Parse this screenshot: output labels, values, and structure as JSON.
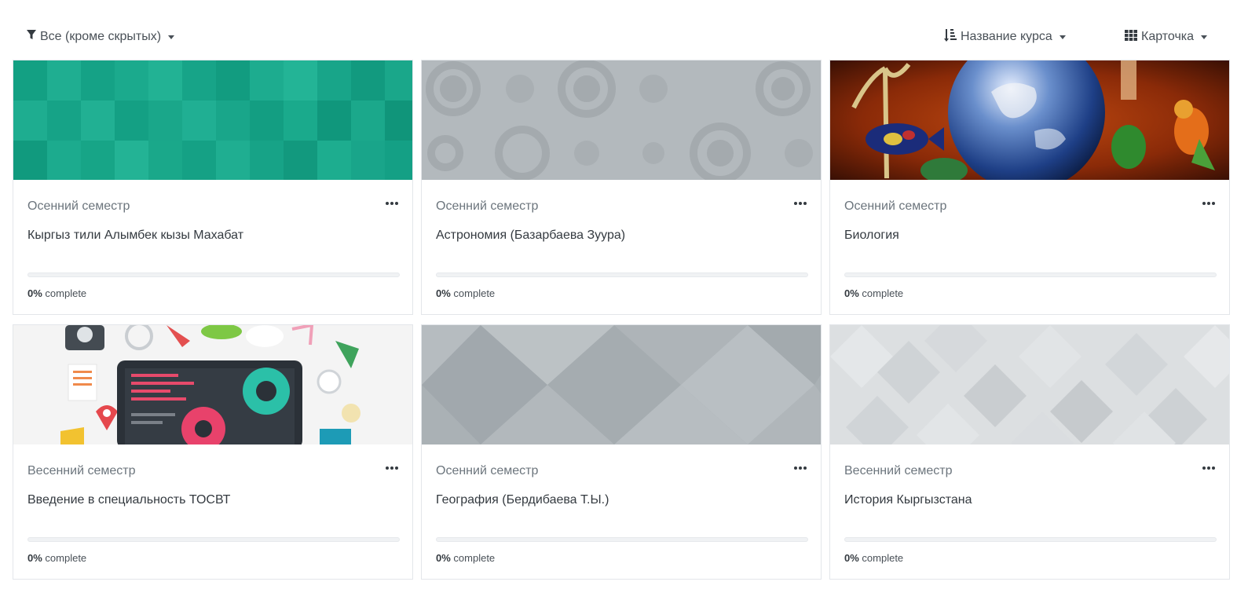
{
  "toolbar": {
    "filter_label": "Все (кроме скрытых)",
    "sort_label": "Название курса",
    "view_label": "Карточка"
  },
  "colors": {
    "accent": "#0f6cbf",
    "teal": "#16a085",
    "gray_pattern": "#b3b9bd"
  },
  "courses": [
    {
      "category": "Осенний семестр",
      "name": "Кыргыз тили Алымбек кызы Махабат",
      "progress_pct": "0%",
      "progress_label": " complete",
      "progress_value": 0
    },
    {
      "category": "Осенний семестр",
      "name": "Астрономия (Базарбаева Зуура)",
      "progress_pct": "0%",
      "progress_label": " complete",
      "progress_value": 0
    },
    {
      "category": "Осенний семестр",
      "name": "Биология",
      "progress_pct": "0%",
      "progress_label": " complete",
      "progress_value": 0
    },
    {
      "category": "Весенний семестр",
      "name": "Введение в специальность ТОСВТ",
      "progress_pct": "0%",
      "progress_label": " complete",
      "progress_value": 0
    },
    {
      "category": "Осенний семестр",
      "name": "География (Бердибаева Т.Ы.)",
      "progress_pct": "0%",
      "progress_label": " complete",
      "progress_value": 0
    },
    {
      "category": "Весенний семестр",
      "name": "История Кыргызстана",
      "progress_pct": "0%",
      "progress_label": " complete",
      "progress_value": 0
    }
  ]
}
